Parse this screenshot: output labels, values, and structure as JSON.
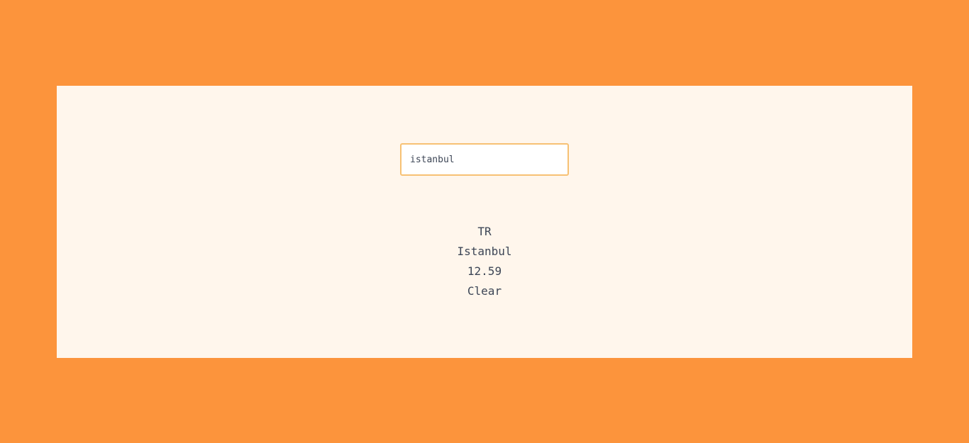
{
  "search": {
    "value": "istanbul",
    "placeholder": ""
  },
  "weather": {
    "country": "TR",
    "city": "Istanbul",
    "temperature": "12.59",
    "condition": "Clear"
  },
  "colors": {
    "background": "#fc943c",
    "card": "#fff6ec",
    "input_border": "#f7c174",
    "text": "#3d4656"
  }
}
